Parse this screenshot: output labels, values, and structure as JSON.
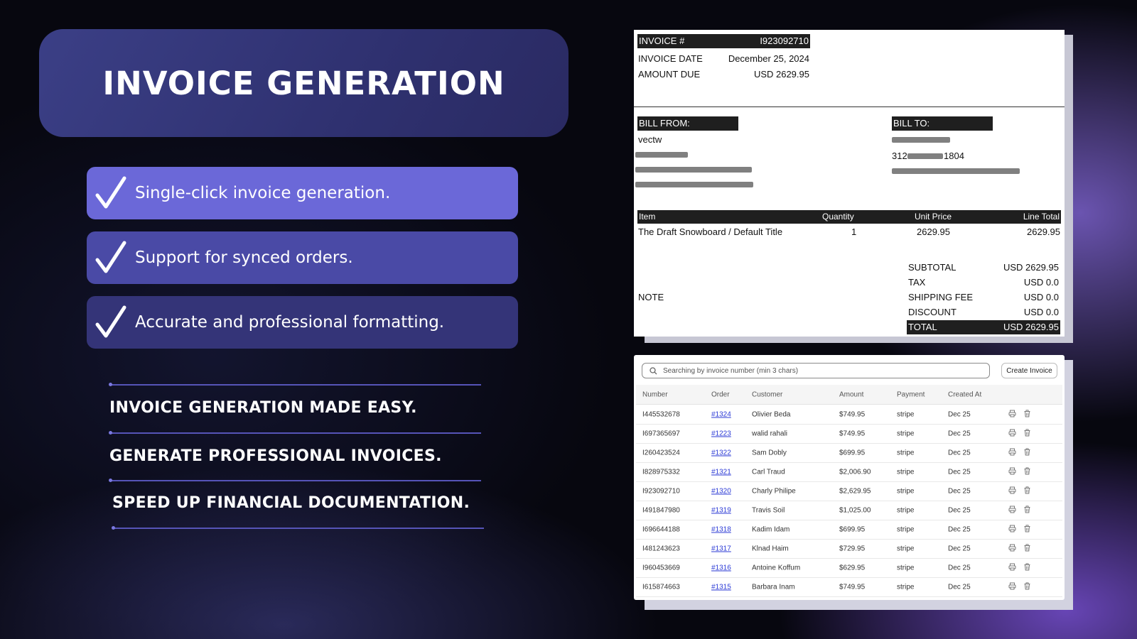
{
  "hero": {
    "title": "INVOICE GENERATION"
  },
  "features": [
    {
      "text": "Single-click invoice generation."
    },
    {
      "text": "Support for synced orders."
    },
    {
      "text": "Accurate and professional formatting."
    }
  ],
  "taglines": [
    "INVOICE GENERATION MADE EASY.",
    "GENERATE PROFESSIONAL INVOICES.",
    "SPEED UP FINANCIAL DOCUMENTATION."
  ],
  "invoice": {
    "number_label": "INVOICE #",
    "number": "I923092710",
    "date_label": "INVOICE DATE",
    "date": "December 25, 2024",
    "amount_due_label": "AMOUNT DUE",
    "amount_due": "USD 2629.95",
    "bill_from_label": "BILL FROM:",
    "bill_from_name": "vectw",
    "bill_to_label": "BILL TO:",
    "bill_to_address_prefix": "312",
    "bill_to_address_suffix": "1804",
    "items_header": {
      "item": "Item",
      "quantity": "Quantity",
      "unit_price": "Unit Price",
      "line_total": "Line Total"
    },
    "items": [
      {
        "item": "The Draft Snowboard / Default Title",
        "quantity": "1",
        "unit_price": "2629.95",
        "line_total": "2629.95"
      }
    ],
    "note_label": "NOTE",
    "subtotal_label": "SUBTOTAL",
    "subtotal": "USD 2629.95",
    "tax_label": "TAX",
    "tax": "USD 0.0",
    "shipping_label": "SHIPPING FEE",
    "shipping": "USD 0.0",
    "discount_label": "DISCOUNT",
    "discount": "USD 0.0",
    "total_label": "TOTAL",
    "total": "USD 2629.95"
  },
  "invoice_list": {
    "search_placeholder": "Searching by invoice number (min 3 chars)",
    "create_button": "Create Invoice",
    "columns": [
      "Number",
      "Order",
      "Customer",
      "Amount",
      "Payment",
      "Created At"
    ],
    "rows": [
      {
        "number": "I445532678",
        "order": "#1324",
        "customer": "Olivier Beda",
        "amount": "$749.95",
        "payment": "stripe",
        "created": "Dec 25"
      },
      {
        "number": "I697365697",
        "order": "#1223",
        "customer": "walid rahali",
        "amount": "$749.95",
        "payment": "stripe",
        "created": "Dec 25"
      },
      {
        "number": "I260423524",
        "order": "#1322",
        "customer": "Sam Dobly",
        "amount": "$699.95",
        "payment": "stripe",
        "created": "Dec 25"
      },
      {
        "number": "I828975332",
        "order": "#1321",
        "customer": "Carl Traud",
        "amount": "$2,006.90",
        "payment": "stripe",
        "created": "Dec 25"
      },
      {
        "number": "I923092710",
        "order": "#1320",
        "customer": "Charly Philipe",
        "amount": "$2,629.95",
        "payment": "stripe",
        "created": "Dec 25"
      },
      {
        "number": "I491847980",
        "order": "#1319",
        "customer": "Travis Soil",
        "amount": "$1,025.00",
        "payment": "stripe",
        "created": "Dec 25"
      },
      {
        "number": "I696644188",
        "order": "#1318",
        "customer": "Kadim Idam",
        "amount": "$699.95",
        "payment": "stripe",
        "created": "Dec 25"
      },
      {
        "number": "I481243623",
        "order": "#1317",
        "customer": "Klnad Haim",
        "amount": "$729.95",
        "payment": "stripe",
        "created": "Dec 25"
      },
      {
        "number": "I960453669",
        "order": "#1316",
        "customer": "Antoine Koffum",
        "amount": "$629.95",
        "payment": "stripe",
        "created": "Dec 25"
      },
      {
        "number": "I615874663",
        "order": "#1315",
        "customer": "Barbara Inam",
        "amount": "$749.95",
        "payment": "stripe",
        "created": "Dec 25"
      }
    ]
  },
  "colors": {
    "accent": "#6b68d8",
    "link": "#2c3bd6"
  }
}
